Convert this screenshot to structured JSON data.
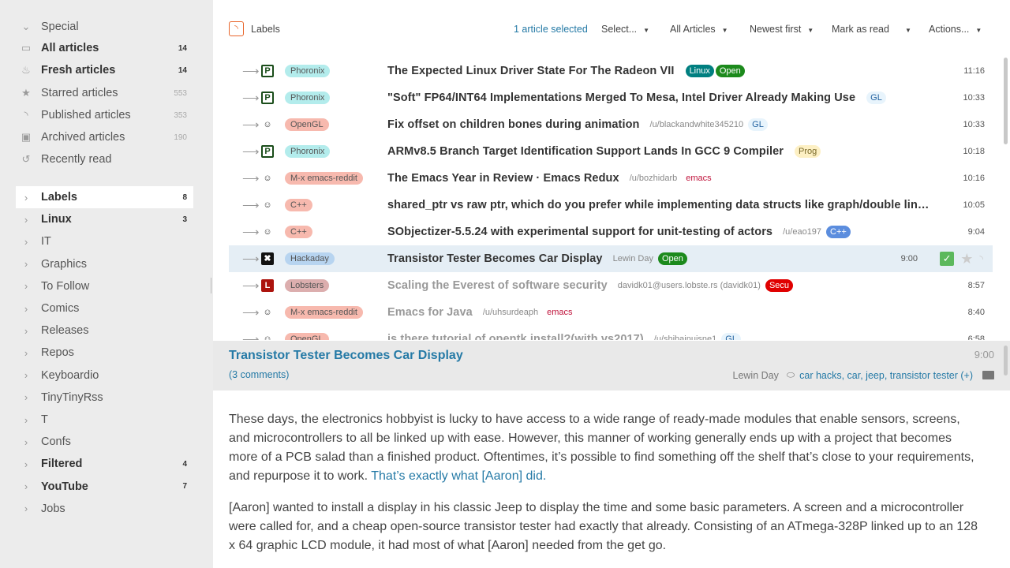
{
  "sidebar": {
    "feeds": [
      {
        "icon": "chevron-down-icon",
        "glyph": "⌄",
        "label": "Special",
        "count": "",
        "bold": false
      },
      {
        "icon": "inbox-icon",
        "glyph": "▭",
        "label": "All articles",
        "count": "14",
        "bold": true
      },
      {
        "icon": "fire-icon",
        "glyph": "♨",
        "label": "Fresh articles",
        "count": "14",
        "bold": true
      },
      {
        "icon": "star-icon",
        "glyph": "★",
        "label": "Starred articles",
        "count": "553",
        "bold": false
      },
      {
        "icon": "rss-icon",
        "glyph": "◝",
        "label": "Published articles",
        "count": "353",
        "bold": false
      },
      {
        "icon": "archive-icon",
        "glyph": "▣",
        "label": "Archived articles",
        "count": "190",
        "bold": false
      },
      {
        "icon": "history-icon",
        "glyph": "↺",
        "label": "Recently read",
        "count": "",
        "bold": false
      }
    ],
    "categories": [
      {
        "label": "Labels",
        "count": "8",
        "bold": true,
        "selected": true
      },
      {
        "label": "Linux",
        "count": "3",
        "bold": true,
        "selected": false
      },
      {
        "label": "IT",
        "count": "",
        "bold": false,
        "selected": false
      },
      {
        "label": "Graphics",
        "count": "",
        "bold": false,
        "selected": false
      },
      {
        "label": "To Follow",
        "count": "",
        "bold": false,
        "selected": false
      },
      {
        "label": "Comics",
        "count": "",
        "bold": false,
        "selected": false
      },
      {
        "label": "Releases",
        "count": "",
        "bold": false,
        "selected": false
      },
      {
        "label": "Repos",
        "count": "",
        "bold": false,
        "selected": false
      },
      {
        "label": "Keyboardio",
        "count": "",
        "bold": false,
        "selected": false
      },
      {
        "label": "TinyTinyRss",
        "count": "",
        "bold": false,
        "selected": false
      },
      {
        "label": "T",
        "count": "",
        "bold": false,
        "selected": false
      },
      {
        "label": "Confs",
        "count": "",
        "bold": false,
        "selected": false
      },
      {
        "label": "Filtered",
        "count": "4",
        "bold": true,
        "selected": false
      },
      {
        "label": "YouTube",
        "count": "7",
        "bold": true,
        "selected": false
      },
      {
        "label": "Jobs",
        "count": "",
        "bold": false,
        "selected": false
      }
    ]
  },
  "toolbar": {
    "feed_title": "Labels",
    "selected_count": "1 article selected",
    "select_label": "Select...",
    "view_mode": "All Articles",
    "order": "Newest first",
    "mark_as_read": "Mark as read",
    "actions": "Actions..."
  },
  "headlines": [
    {
      "feed": "Phoronix",
      "feed_color": "#b3ecec",
      "icon": "phoronix-icon",
      "title": "The Expected Linux Driver State For The Radeon VII",
      "author": "",
      "labels": [
        {
          "text": "Linux",
          "bg": "#007f80",
          "fg": "#ffffff"
        },
        {
          "text": "Open",
          "bg": "#1c8a1c",
          "fg": "#ffffff"
        }
      ],
      "time": "11:16",
      "read": false,
      "selected": false
    },
    {
      "feed": "Phoronix",
      "feed_color": "#b3ecec",
      "icon": "phoronix-icon",
      "title": "\"Soft\" FP64/INT64 Implementations Merged To Mesa, Intel Driver Already Making Use",
      "author": "",
      "labels": [
        {
          "text": "GL",
          "bg": "#e8f4fc",
          "fg": "#2262a0"
        }
      ],
      "time": "10:33",
      "read": false,
      "selected": false
    },
    {
      "feed": "OpenGL",
      "feed_color": "#f7b9ae",
      "icon": "reddit-icon",
      "title": "Fix offset on children bones during animation",
      "author": "/u/blackandwhite345210",
      "labels": [
        {
          "text": "GL",
          "bg": "#e8f4fc",
          "fg": "#2262a0"
        }
      ],
      "time": "10:33",
      "read": false,
      "selected": false
    },
    {
      "feed": "Phoronix",
      "feed_color": "#b3ecec",
      "icon": "phoronix-icon",
      "title": "ARMv8.5 Branch Target Identification Support Lands In GCC 9 Compiler",
      "author": "",
      "labels": [
        {
          "text": "Prog",
          "bg": "#fdf0c4",
          "fg": "#7a6a2a"
        }
      ],
      "time": "10:18",
      "read": false,
      "selected": false
    },
    {
      "feed": "M-x emacs-reddit",
      "feed_color": "#f7b9ae",
      "icon": "reddit-icon",
      "title": "The Emacs Year in Review · Emacs Redux",
      "author": "/u/bozhidarb",
      "labels": [
        {
          "text": "emacs",
          "bg": "transparent",
          "fg": "#c0143c"
        }
      ],
      "time": "10:16",
      "read": false,
      "selected": false
    },
    {
      "feed": "C++",
      "feed_color": "#f7b9ae",
      "icon": "reddit-icon",
      "title": "shared_ptr vs raw ptr, which do you prefer while implementing data structs like graph/double lin…",
      "author": "",
      "labels": [],
      "time": "10:05",
      "read": false,
      "selected": false
    },
    {
      "feed": "C++",
      "feed_color": "#f7b9ae",
      "icon": "reddit-icon",
      "title": "SObjectizer-5.5.24 with experimental support for unit-testing of actors",
      "author": "/u/eao197",
      "labels": [
        {
          "text": "C++",
          "bg": "#5b8dde",
          "fg": "#ffffff"
        }
      ],
      "time": "9:04",
      "read": false,
      "selected": false
    },
    {
      "feed": "Hackaday",
      "feed_color": "#b7d4f0",
      "icon": "hackaday-icon",
      "title": "Transistor Tester Becomes Car Display",
      "author": "Lewin Day",
      "labels": [
        {
          "text": "Open",
          "bg": "#1c8a1c",
          "fg": "#ffffff"
        }
      ],
      "time": "9:00",
      "read": false,
      "selected": true
    },
    {
      "feed": "Lobsters",
      "feed_color": "#dcaeae",
      "icon": "lobsters-icon",
      "title": "Scaling the Everest of software security",
      "author": "davidk01@users.lobste.rs (davidk01)",
      "labels": [
        {
          "text": "Secu",
          "bg": "#e00000",
          "fg": "#ffffff"
        }
      ],
      "time": "8:57",
      "read": true,
      "selected": false
    },
    {
      "feed": "M-x emacs-reddit",
      "feed_color": "#f7b9ae",
      "icon": "reddit-icon",
      "title": "Emacs for Java",
      "author": "/u/uhsurdeaph",
      "labels": [
        {
          "text": "emacs",
          "bg": "transparent",
          "fg": "#c0143c"
        }
      ],
      "time": "8:40",
      "read": true,
      "selected": false
    },
    {
      "feed": "OpenGL",
      "feed_color": "#f7b9ae",
      "icon": "reddit-icon",
      "title": "is there tutorial of opentk install?(with vs2017)",
      "author": "/u/shibainuisne1",
      "labels": [
        {
          "text": "GL",
          "bg": "#e8f4fc",
          "fg": "#2262a0"
        }
      ],
      "time": "6:58",
      "read": true,
      "selected": false
    }
  ],
  "article": {
    "title": "Transistor Tester Becomes Car Display",
    "time": "9:00",
    "comments": "(3 comments)",
    "author": "Lewin Day",
    "tags": "car hacks, car, jeep, transistor tester (+)",
    "p1_text": "These days, the electronics hobbyist is lucky to have access to a wide range of ready-made modules that enable sensors, screens, and microcontrollers to all be linked up with ease. However, this manner of working generally ends up with a project that becomes more of a PCB salad than a finished product. Oftentimes, it’s possible to find something off the shelf that’s close to your require­ments, and repurpose it to work. ",
    "p1_link": "That’s exactly what [Aaron] did.",
    "p2_text": "[Aaron] wanted to install a display in his classic Jeep to display the time and some basic parameters. A screen and a microcontroller were called for, and a cheap open-source transistor tester had exactly that already. Consisting of an ATmega-328P linked up to an 128 x 64 graphic LCD module, it had most of what [Aaron] needed from the get go."
  }
}
